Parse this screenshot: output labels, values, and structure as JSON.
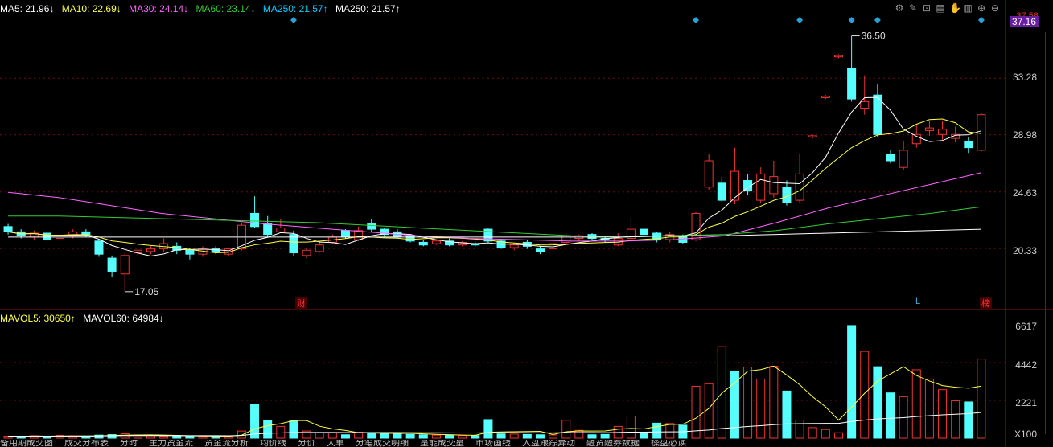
{
  "legend": {
    "ma5": "MA5: 21.96↓",
    "ma10": "MA10: 22.69↓",
    "ma30": "MA30: 24.14↓",
    "ma60": "MA60: 23.14↓",
    "ma250a": "MA250: 21.57↑",
    "ma250b": "MA250: 21.57↑"
  },
  "volume_legend": {
    "mavol5": "MAVOL5: 30650↑",
    "mavol60": "MAVOL60: 64984↓"
  },
  "price_axis": {
    "top": "37.16",
    "l1": "33.28",
    "l2": "28.98",
    "l3": "24.63",
    "l4": "20.33"
  },
  "volume_axis": {
    "v1": "6617",
    "v2": "4442",
    "v3": "2221",
    "unit": "X100"
  },
  "annotations": {
    "high": "36.50",
    "low": "17.05",
    "tag_cai": "财",
    "tag_L": "L",
    "tag_bang": "榜",
    "current": "37.16",
    "top_axis": "37.58"
  },
  "colors": {
    "up": "#e33",
    "down": "#5ff",
    "ma5": "#ffffff",
    "ma10": "#ffff44",
    "ma30": "#ff66ff",
    "ma60": "#33cc33",
    "ma250": "#00ccff",
    "ma250b": "#ff9933"
  },
  "tabs": [
    "备用期成交图",
    "成交分布表",
    "分时",
    "主力资金流",
    "资金流分析",
    "均价线",
    "分价",
    "大单",
    "分笔成交明细",
    "量能成交量",
    "市场画线",
    "大盘跟踪异动",
    "融资融券数据",
    "操盘必读"
  ],
  "chart_data": {
    "type": "candlestick",
    "price_ticks": [
      20.33,
      24.63,
      28.98,
      33.28,
      37.16
    ],
    "volume_ticks": [
      2221,
      4442,
      6617
    ],
    "high_label": 36.5,
    "low_label": 17.05,
    "candles": [
      [
        22.0,
        21.6,
        22.2,
        21.4
      ],
      [
        21.6,
        21.3,
        21.8,
        21.1
      ],
      [
        21.2,
        21.5,
        21.7,
        21.0
      ],
      [
        21.5,
        21.0,
        21.6,
        20.8
      ],
      [
        21.1,
        21.3,
        21.4,
        20.9
      ],
      [
        21.3,
        21.6,
        21.8,
        21.1
      ],
      [
        21.6,
        21.4,
        21.8,
        21.2
      ],
      [
        20.9,
        19.9,
        21.0,
        19.7
      ],
      [
        19.6,
        18.6,
        19.8,
        18.2
      ],
      [
        18.4,
        19.8,
        20.0,
        17.05
      ],
      [
        20.0,
        20.2,
        20.4,
        19.8
      ],
      [
        20.1,
        20.3,
        20.5,
        19.9
      ],
      [
        20.3,
        20.7,
        21.1,
        20.1
      ],
      [
        20.5,
        20.2,
        20.8,
        19.9
      ],
      [
        20.2,
        19.9,
        20.4,
        19.5
      ],
      [
        19.9,
        20.3,
        20.5,
        19.7
      ],
      [
        20.3,
        20.1,
        20.5,
        19.9
      ],
      [
        19.9,
        20.3,
        20.4,
        19.8
      ],
      [
        20.3,
        22.1,
        22.3,
        20.2
      ],
      [
        23.0,
        22.0,
        24.3,
        21.9
      ],
      [
        22.2,
        21.4,
        22.8,
        21.2
      ],
      [
        21.6,
        21.9,
        22.6,
        21.5
      ],
      [
        21.4,
        20.0,
        21.7,
        19.8
      ],
      [
        19.8,
        20.2,
        20.4,
        19.6
      ],
      [
        20.1,
        20.6,
        20.8,
        20.0
      ],
      [
        20.8,
        21.2,
        21.4,
        20.7
      ],
      [
        21.7,
        21.2,
        21.8,
        21.1
      ],
      [
        21.0,
        21.7,
        22.0,
        20.9
      ],
      [
        22.2,
        21.8,
        22.6,
        21.6
      ],
      [
        21.8,
        21.4,
        21.9,
        21.2
      ],
      [
        21.6,
        21.2,
        21.8,
        21.1
      ],
      [
        21.3,
        20.9,
        21.4,
        20.8
      ],
      [
        20.8,
        20.6,
        21.0,
        20.5
      ],
      [
        20.7,
        20.9,
        21.0,
        20.6
      ],
      [
        20.9,
        20.6,
        21.1,
        20.5
      ],
      [
        20.6,
        20.8,
        20.9,
        20.5
      ],
      [
        20.7,
        20.6,
        20.8,
        20.5
      ],
      [
        21.8,
        20.9,
        21.9,
        20.8
      ],
      [
        20.9,
        20.4,
        21.0,
        20.3
      ],
      [
        20.4,
        20.6,
        20.8,
        20.2
      ],
      [
        20.8,
        20.5,
        21.0,
        20.3
      ],
      [
        20.3,
        20.1,
        20.5,
        19.9
      ],
      [
        20.3,
        20.7,
        20.9,
        20.2
      ],
      [
        20.8,
        21.3,
        21.5,
        20.7
      ],
      [
        21.1,
        21.3,
        21.4,
        20.9
      ],
      [
        21.4,
        21.1,
        21.5,
        20.9
      ],
      [
        21.1,
        21.0,
        21.3,
        20.8
      ],
      [
        20.6,
        21.1,
        21.5,
        20.5
      ],
      [
        21.1,
        21.8,
        22.7,
        20.9
      ],
      [
        21.8,
        21.4,
        22.0,
        21.2
      ],
      [
        21.5,
        21.0,
        21.6,
        20.8
      ],
      [
        21.0,
        21.4,
        21.6,
        20.8
      ],
      [
        21.3,
        20.8,
        21.4,
        20.7
      ],
      [
        21.0,
        23.0,
        23.1,
        20.9
      ],
      [
        25.0,
        27.0,
        27.5,
        24.8
      ],
      [
        25.3,
        24.0,
        25.8,
        23.9
      ],
      [
        24.0,
        26.2,
        28.0,
        23.7
      ],
      [
        25.5,
        24.7,
        26.0,
        24.4
      ],
      [
        24.0,
        26.0,
        26.5,
        23.8
      ],
      [
        24.5,
        25.8,
        27.0,
        24.2
      ],
      [
        25.0,
        23.8,
        25.5,
        23.6
      ],
      [
        24.0,
        26.0,
        27.5,
        23.8
      ],
      [
        28.8,
        28.9,
        29.0,
        28.7
      ],
      [
        31.8,
        31.9,
        32.0,
        31.7
      ],
      [
        34.9,
        35.0,
        35.1,
        34.8
      ],
      [
        34.0,
        31.7,
        36.5,
        31.5
      ],
      [
        31.0,
        31.5,
        33.5,
        30.5
      ],
      [
        32.0,
        29.0,
        32.8,
        28.8
      ],
      [
        27.5,
        27.0,
        27.8,
        26.8
      ],
      [
        26.5,
        27.8,
        28.5,
        26.3
      ],
      [
        28.3,
        29.0,
        29.8,
        28.0
      ],
      [
        29.3,
        29.5,
        30.0,
        28.9
      ],
      [
        29.0,
        29.4,
        30.0,
        28.6
      ],
      [
        28.7,
        29.0,
        29.6,
        28.4
      ],
      [
        28.5,
        28.0,
        28.8,
        27.6
      ],
      [
        27.8,
        30.5,
        30.6,
        27.7
      ]
    ],
    "volumes": [
      [
        120,
        false
      ],
      [
        110,
        true
      ],
      [
        140,
        false
      ],
      [
        100,
        true
      ],
      [
        160,
        false
      ],
      [
        130,
        false
      ],
      [
        120,
        true
      ],
      [
        180,
        true
      ],
      [
        210,
        true
      ],
      [
        260,
        false
      ],
      [
        170,
        false
      ],
      [
        150,
        false
      ],
      [
        120,
        false
      ],
      [
        130,
        true
      ],
      [
        140,
        true
      ],
      [
        120,
        false
      ],
      [
        110,
        true
      ],
      [
        100,
        false
      ],
      [
        420,
        false
      ],
      [
        1990,
        true
      ],
      [
        1050,
        true
      ],
      [
        690,
        false
      ],
      [
        1010,
        true
      ],
      [
        420,
        false
      ],
      [
        330,
        false
      ],
      [
        310,
        false
      ],
      [
        200,
        true
      ],
      [
        350,
        false
      ],
      [
        310,
        true
      ],
      [
        280,
        true
      ],
      [
        250,
        true
      ],
      [
        220,
        true
      ],
      [
        200,
        true
      ],
      [
        180,
        false
      ],
      [
        170,
        true
      ],
      [
        160,
        false
      ],
      [
        150,
        true
      ],
      [
        1090,
        true
      ],
      [
        250,
        true
      ],
      [
        240,
        false
      ],
      [
        220,
        true
      ],
      [
        200,
        true
      ],
      [
        190,
        false
      ],
      [
        1050,
        false
      ],
      [
        460,
        false
      ],
      [
        200,
        true
      ],
      [
        220,
        true
      ],
      [
        690,
        false
      ],
      [
        1300,
        false
      ],
      [
        300,
        true
      ],
      [
        880,
        true
      ],
      [
        860,
        false
      ],
      [
        760,
        true
      ],
      [
        3050,
        false
      ],
      [
        3200,
        false
      ],
      [
        5380,
        false
      ],
      [
        3900,
        true
      ],
      [
        4180,
        false
      ],
      [
        3480,
        false
      ],
      [
        4230,
        false
      ],
      [
        2770,
        true
      ],
      [
        1060,
        false
      ],
      [
        620,
        false
      ],
      [
        510,
        false
      ],
      [
        320,
        false
      ],
      [
        6620,
        true
      ],
      [
        5100,
        false
      ],
      [
        4200,
        true
      ],
      [
        2660,
        true
      ],
      [
        2440,
        false
      ],
      [
        4020,
        false
      ],
      [
        3480,
        false
      ],
      [
        2850,
        false
      ],
      [
        2200,
        false
      ],
      [
        2130,
        true
      ],
      [
        4650,
        false
      ]
    ]
  }
}
